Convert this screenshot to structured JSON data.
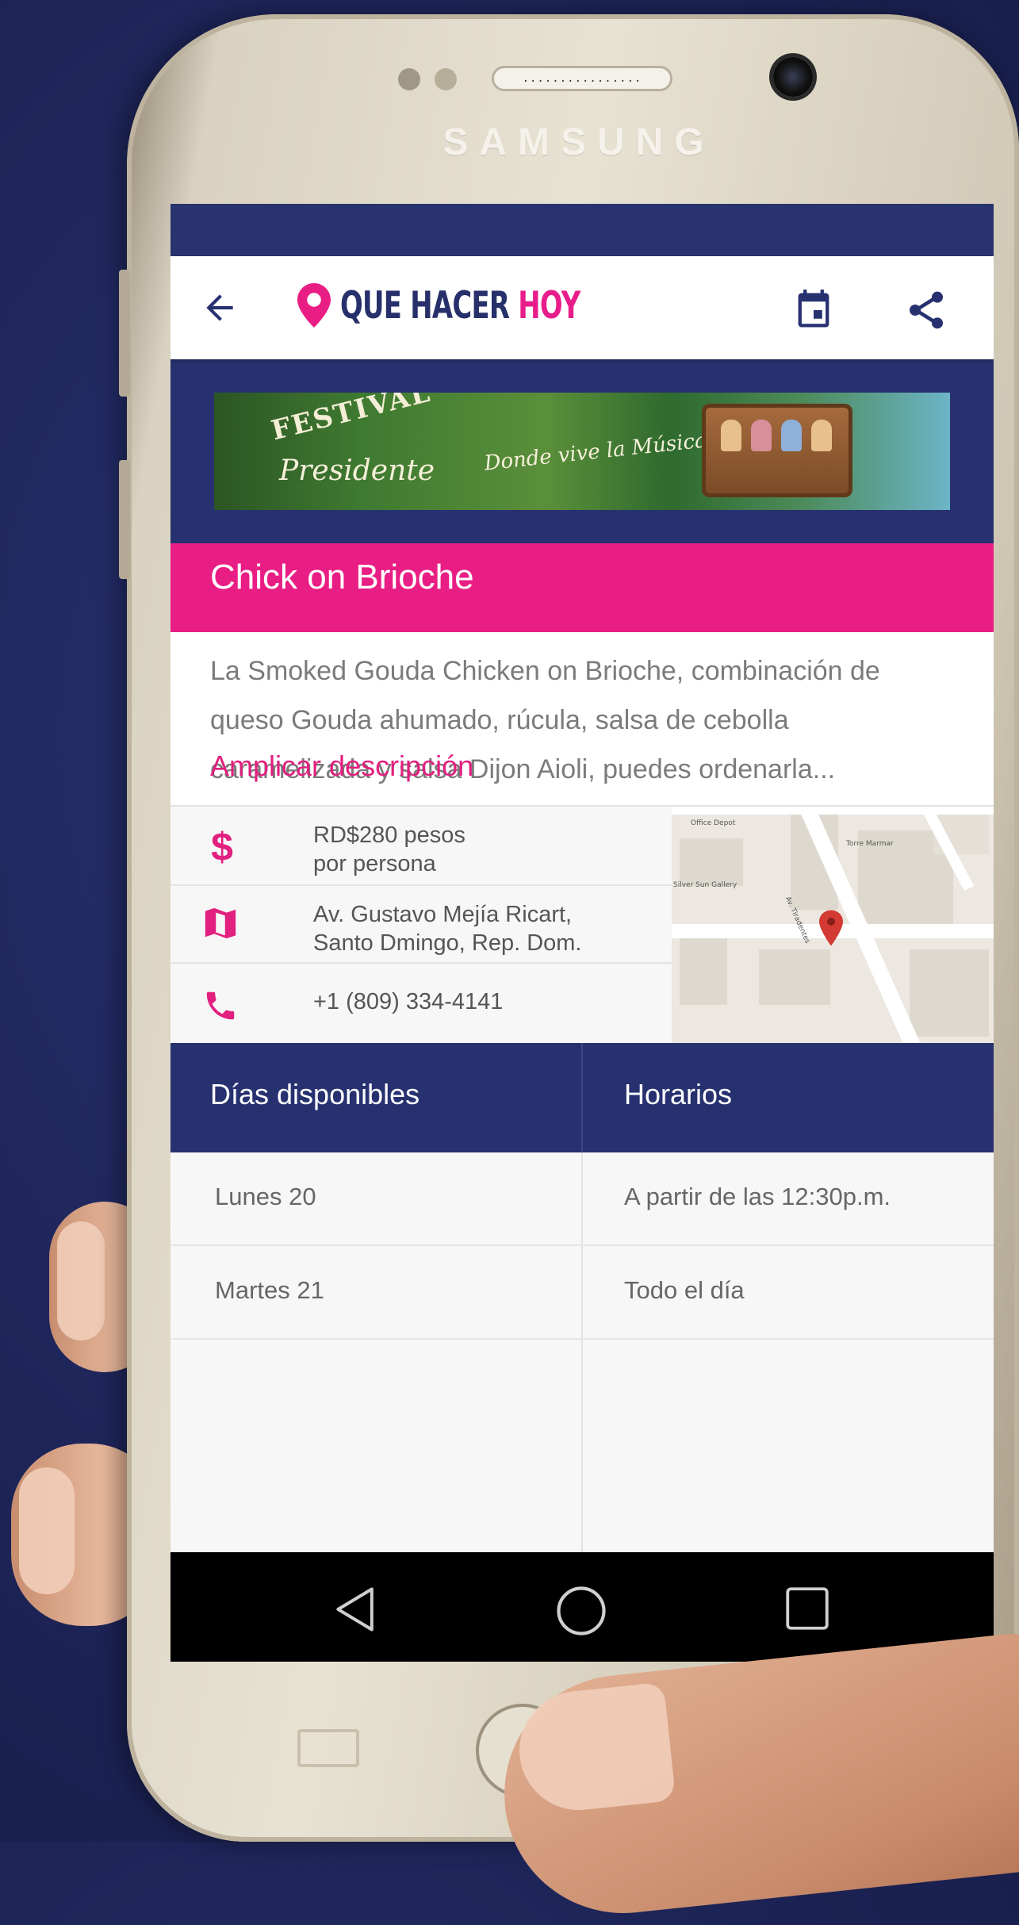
{
  "device": {
    "brand": "SAMSUNG",
    "speaker_grille": "................"
  },
  "app": {
    "logo_main": "QUE HACER ",
    "logo_accent": "HOY",
    "accent_color": "#e91e84",
    "primary_color": "#273170"
  },
  "banner": {
    "festival_text": "FESTIVAL",
    "brand_text": "Presidente",
    "tagline": "Donde vive la Música"
  },
  "event": {
    "title": "Chick on Brioche",
    "description": "La Smoked Gouda Chicken on Brioche, combinación de queso Gouda ahumado, rúcula, salsa de cebolla caramelizada y salsa Dijon Aioli, puedes ordenarla...",
    "more_link": "Amplicar descripción"
  },
  "info": {
    "price_line1": "RD$280 pesos",
    "price_line2": "por persona",
    "address_line1": "Av. Gustavo Mejía Ricart,",
    "address_line2": "Santo Dmingo, Rep. Dom.",
    "phone": "+1 (809) 334-4141",
    "price_icon": "$"
  },
  "map": {
    "label_office": "Office Depot",
    "label_gallery": "Silver Sun Gallery",
    "label_torre": "Torre Marmar",
    "label_street": "Av. Tiradentes"
  },
  "schedule": {
    "col_days": "Días disponibles",
    "col_hours": "Horarios",
    "rows": [
      {
        "day": "Lunes 20",
        "hours": "A partir de las 12:30p.m."
      },
      {
        "day": "Martes 21",
        "hours": "Todo el día"
      }
    ]
  }
}
